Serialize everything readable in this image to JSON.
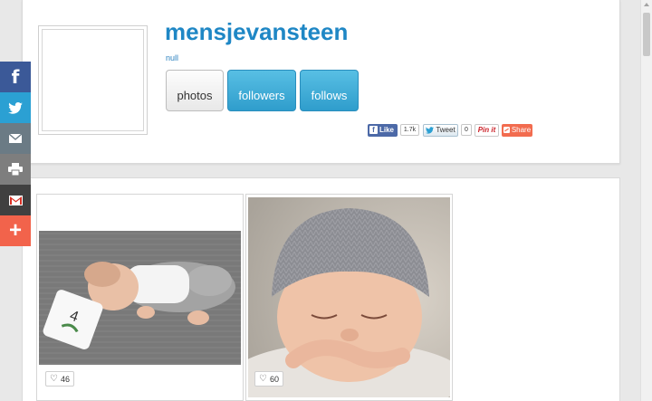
{
  "profile": {
    "username": "mensjevansteen",
    "subtitle": "null",
    "tabs": [
      {
        "label": "photos"
      },
      {
        "label": "followers"
      },
      {
        "label": "follows"
      }
    ]
  },
  "share_buttons": {
    "facebook_like": "Like",
    "facebook_count": "1.7k",
    "tweet": "Tweet",
    "tweet_count": "0",
    "pinit": "Pin it",
    "share": "Share"
  },
  "photos": [
    {
      "likes": "46",
      "description": "newborn baby lying on a grey blanket with a 4 weeks milestone card"
    },
    {
      "likes": "60",
      "description": "sleeping newborn in a grey knitted hat"
    }
  ],
  "social_sidebar": [
    {
      "icon": "facebook-icon"
    },
    {
      "icon": "twitter-icon"
    },
    {
      "icon": "email-icon"
    },
    {
      "icon": "print-icon"
    },
    {
      "icon": "gmail-icon"
    },
    {
      "icon": "plus-icon"
    }
  ],
  "colors": {
    "accent": "#1f87c5",
    "tab_active": "#3aa8d5",
    "facebook": "#3b5998",
    "twitter": "#2ba0d3",
    "share": "#f2634b"
  }
}
